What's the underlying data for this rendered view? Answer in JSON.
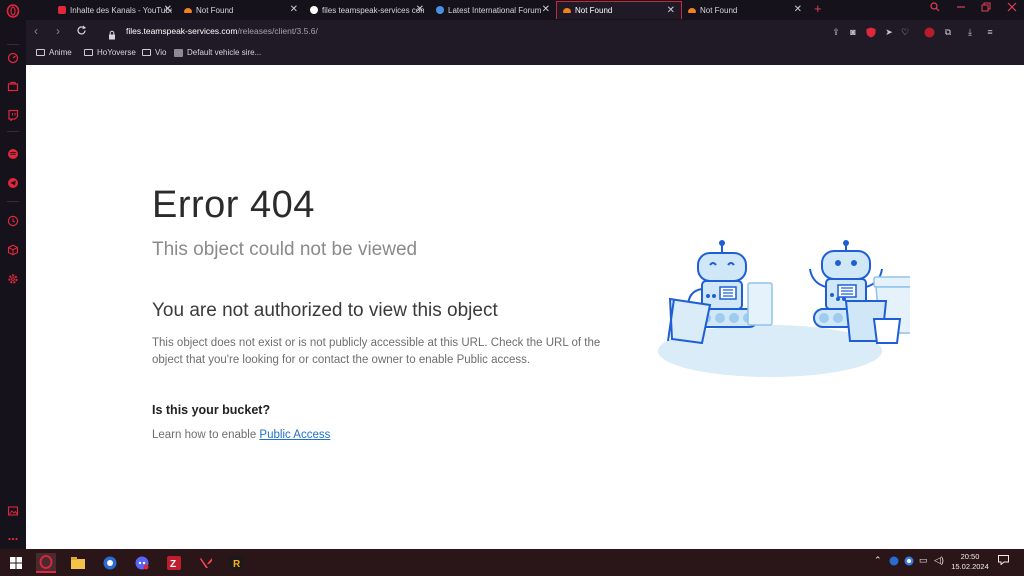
{
  "tabs": [
    {
      "label": "Inhalte des Kanals - YouTube",
      "favicon": "youtube-icon",
      "active": false
    },
    {
      "label": "Not Found",
      "favicon": "cloudflare-icon",
      "active": false
    },
    {
      "label": "files teamspeak-services com",
      "favicon": "google-icon",
      "active": false
    },
    {
      "label": "Latest International Forum",
      "favicon": "forum-globe-icon",
      "active": false
    },
    {
      "label": "Not Found",
      "favicon": "cloudflare-icon",
      "active": true
    },
    {
      "label": "Not Found",
      "favicon": "cloudflare-icon",
      "active": false
    }
  ],
  "address": {
    "host": "files.teamspeak-services.com",
    "path": "/releases/client/3.5.6/"
  },
  "bookmarks": [
    {
      "label": "Anime",
      "icon": "folder-icon"
    },
    {
      "label": "HoYoverse",
      "icon": "folder-icon"
    },
    {
      "label": "Vio",
      "icon": "folder-icon"
    },
    {
      "label": "Default vehicle sire...",
      "icon": "site-icon"
    }
  ],
  "page": {
    "title": "Error 404",
    "subtitle": "This object could not be viewed",
    "heading": "You are not authorized to view this object",
    "description": "This object does not exist or is not publicly accessible at this URL. Check the URL of the object that you're looking for or contact the owner to enable Public access.",
    "bucket_heading": "Is this your bucket?",
    "learn_text": "Learn how to enable ",
    "learn_link": "Public Access"
  },
  "clock": {
    "time": "20:50",
    "date": "15.02.2024"
  },
  "colors": {
    "accent": "#c8283c",
    "link": "#1f6fd0",
    "robot_blue": "#1f5fd6",
    "robot_light": "#cfe7f7"
  }
}
